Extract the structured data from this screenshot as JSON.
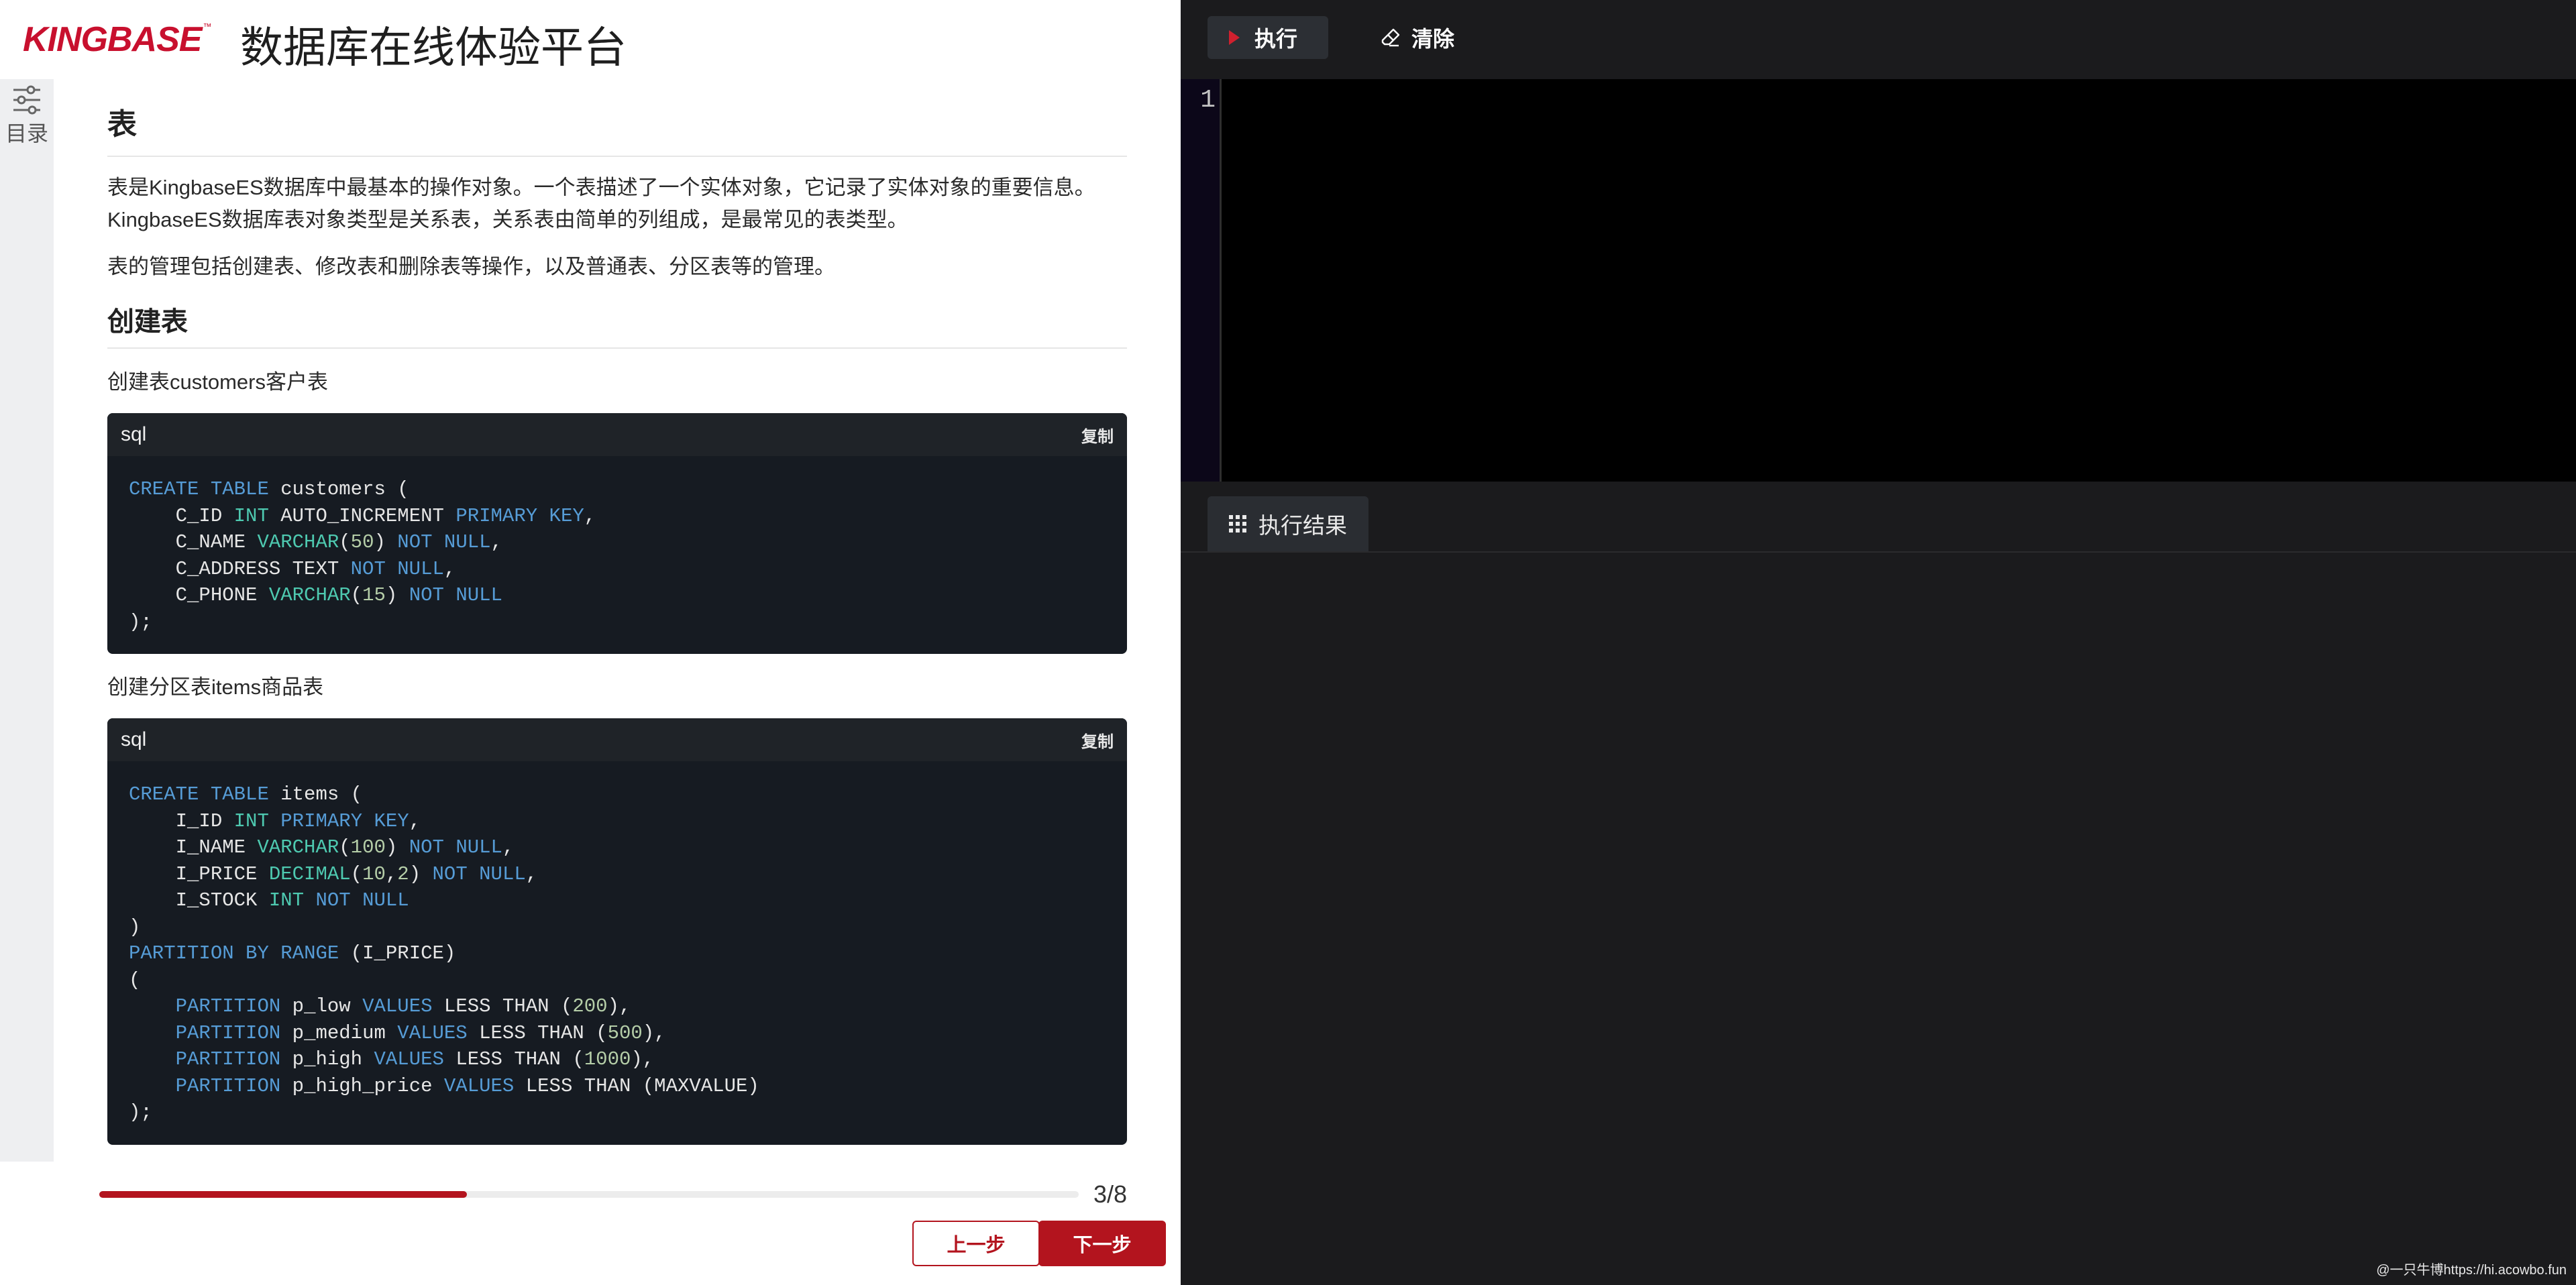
{
  "header": {
    "logo_text": "KINGBASE",
    "logo_tm": "™",
    "title": "数据库在线体验平台"
  },
  "toc": {
    "label": "目录"
  },
  "content": {
    "heading": "表",
    "paragraph1": "表是KingbaseES数据库中最基本的操作对象。一个表描述了一个实体对象，它记录了实体对象的重要信息。KingbaseES数据库表对象类型是关系表，关系表由简单的列组成，是最常见的表类型。",
    "paragraph2": "表的管理包括创建表、修改表和删除表等操作，以及普通表、分区表等的管理。",
    "subheading": "创建表",
    "caption1": "创建表customers客户表",
    "caption2": "创建分区表items商品表",
    "code_lang": "sql",
    "copy_label": "复制",
    "code1": [
      "CREATE TABLE customers (",
      "    C_ID INT AUTO_INCREMENT PRIMARY KEY,",
      "    C_NAME VARCHAR(50) NOT NULL,",
      "    C_ADDRESS TEXT NOT NULL,",
      "    C_PHONE VARCHAR(15) NOT NULL",
      ");"
    ],
    "code2": [
      "CREATE TABLE items (",
      "    I_ID INT PRIMARY KEY,",
      "    I_NAME VARCHAR(100) NOT NULL,",
      "    I_PRICE DECIMAL(10,2) NOT NULL,",
      "    I_STOCK INT NOT NULL",
      ")",
      "PARTITION BY RANGE (I_PRICE)",
      "(",
      "    PARTITION p_low VALUES LESS THAN (200),",
      "    PARTITION p_medium VALUES LESS THAN (500),",
      "    PARTITION p_high VALUES LESS THAN (1000),",
      "    PARTITION p_high_price VALUES LESS THAN (MAXVALUE)",
      ");"
    ]
  },
  "footer": {
    "progress_current": 3,
    "progress_total": 8,
    "progress_fraction": 0.375,
    "progress_label": "3/8",
    "prev_label": "上一步",
    "next_label": "下一步"
  },
  "toolbar": {
    "run_label": "执行",
    "clear_label": "清除"
  },
  "editor": {
    "line_number": "1"
  },
  "results": {
    "tab_label": "执行结果"
  },
  "watermark": "@一只牛博https://hi.acowbo.fun",
  "colors": {
    "brand": "#b3141e",
    "accent_red": "#c8102e",
    "dark_bg": "#1b1b1d"
  }
}
